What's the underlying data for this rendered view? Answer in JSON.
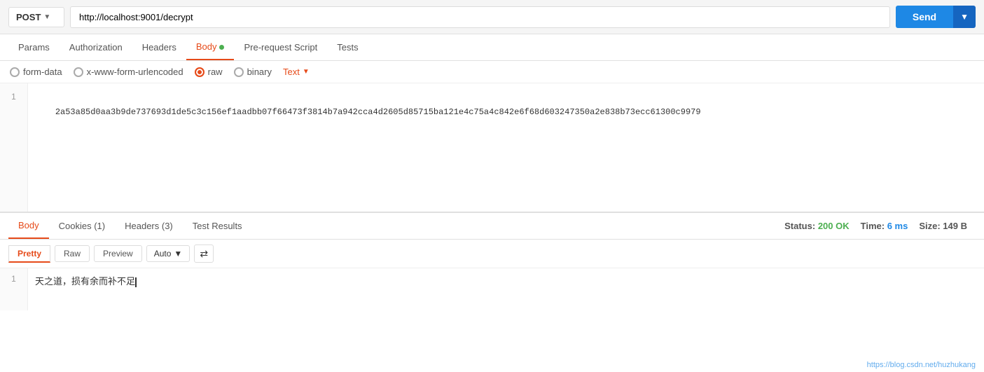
{
  "topbar": {
    "method": "POST",
    "url": "http://localhost:9001/decrypt",
    "send_label": "Send",
    "send_arrow": "▼"
  },
  "request_tabs": [
    {
      "id": "params",
      "label": "Params",
      "active": false,
      "dot": false
    },
    {
      "id": "authorization",
      "label": "Authorization",
      "active": false,
      "dot": false
    },
    {
      "id": "headers",
      "label": "Headers",
      "active": false,
      "dot": false
    },
    {
      "id": "body",
      "label": "Body",
      "active": true,
      "dot": true
    },
    {
      "id": "pre-request-script",
      "label": "Pre-request Script",
      "active": false,
      "dot": false
    },
    {
      "id": "tests",
      "label": "Tests",
      "active": false,
      "dot": false
    }
  ],
  "body_options": [
    {
      "id": "form-data",
      "label": "form-data",
      "selected": false
    },
    {
      "id": "x-www-form-urlencoded",
      "label": "x-www-form-urlencoded",
      "selected": false
    },
    {
      "id": "raw",
      "label": "raw",
      "selected": true
    },
    {
      "id": "binary",
      "label": "binary",
      "selected": false
    }
  ],
  "text_dropdown": {
    "label": "Text",
    "arrow": "▼"
  },
  "request_body": {
    "line1": "2a53a85d0aa3b9de737693d1de5c3c156ef1aadbb07f66473f3814b7a942cca4d2605d85715ba121e4c75a4c842e6f68d603247350a2e838b73ecc61300c9979"
  },
  "response_tabs": [
    {
      "id": "body",
      "label": "Body",
      "active": true
    },
    {
      "id": "cookies",
      "label": "Cookies (1)",
      "active": false
    },
    {
      "id": "headers",
      "label": "Headers (3)",
      "active": false
    },
    {
      "id": "test-results",
      "label": "Test Results",
      "active": false
    }
  ],
  "response_meta": {
    "status_label": "Status:",
    "status_value": "200 OK",
    "time_label": "Time:",
    "time_value": "6 ms",
    "size_label": "Size:",
    "size_value": "149 B"
  },
  "response_toolbar": {
    "views": [
      "Pretty",
      "Raw",
      "Preview"
    ],
    "active_view": "Pretty",
    "format": "Auto",
    "format_arrow": "▼",
    "wrap_icon": "⇄"
  },
  "response_body": {
    "line1": "天之道，损有余而补不足"
  },
  "watermark": "https://blog.csdn.net/huzhukang"
}
